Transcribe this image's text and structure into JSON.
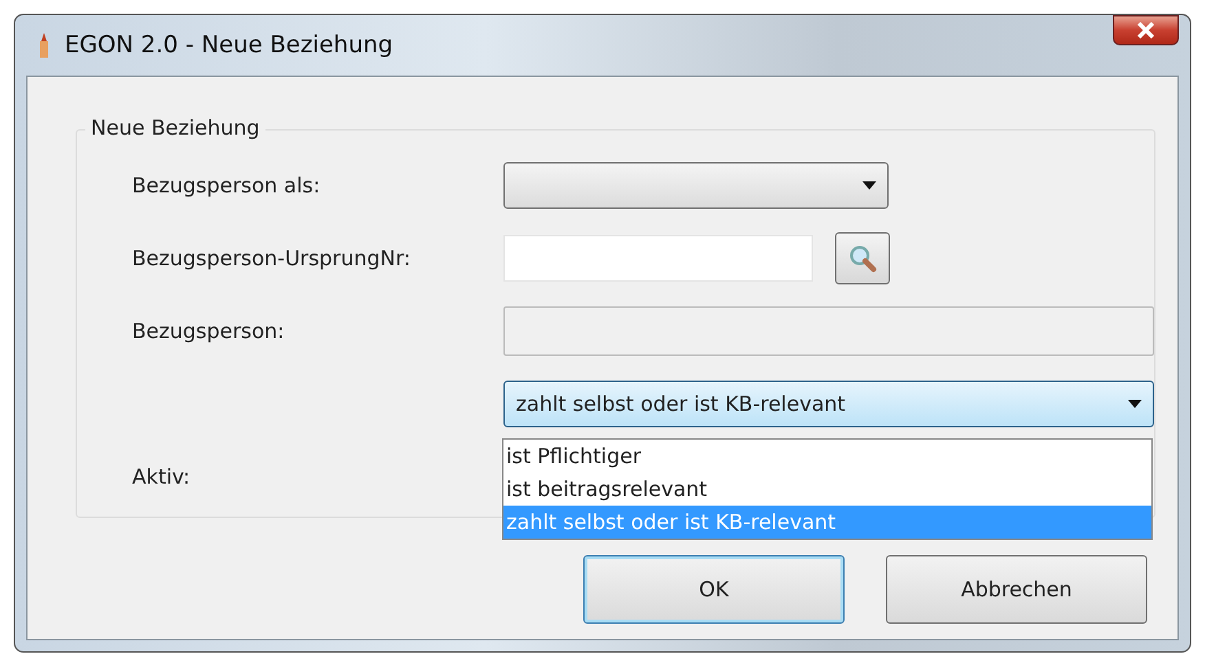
{
  "window": {
    "title": "EGON 2.0 - Neue Beziehung"
  },
  "group": {
    "title": "Neue Beziehung"
  },
  "rows": [
    {
      "label": "Bezugsperson als:",
      "kind": "combo",
      "value": ""
    },
    {
      "label": "Bezugsperson-UrsprungNr:",
      "kind": "lookup",
      "value": ""
    },
    {
      "label": "Bezugsperson:",
      "kind": "readonly",
      "value": ""
    },
    {
      "label": "",
      "kind": "opencombo",
      "value": "zahlt selbst oder ist KB-relevant"
    },
    {
      "label": "Aktiv:",
      "kind": "blank",
      "value": ""
    }
  ],
  "dropdown": {
    "options": [
      {
        "label": "ist Pflichtiger",
        "selected": false
      },
      {
        "label": "ist beitragsrelevant",
        "selected": false
      },
      {
        "label": "zahlt selbst oder ist KB-relevant",
        "selected": true
      }
    ]
  },
  "buttons": [
    {
      "label": "OK",
      "default": true
    },
    {
      "label": "Abbrechen",
      "default": false
    }
  ]
}
